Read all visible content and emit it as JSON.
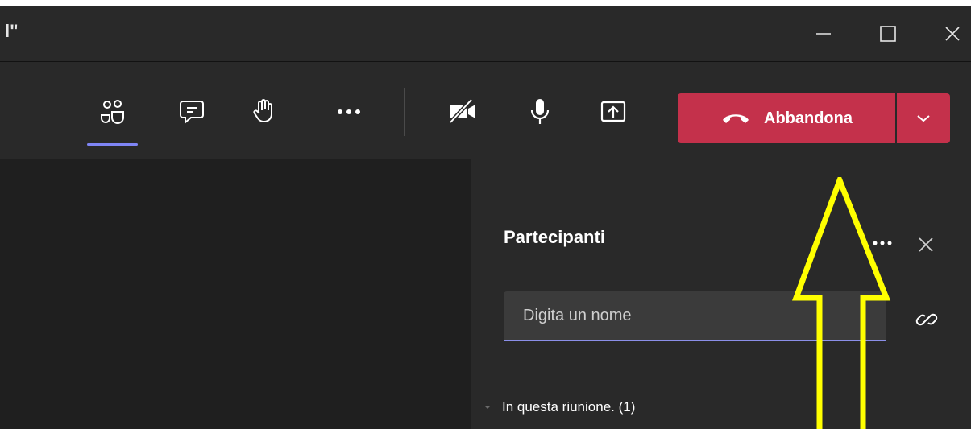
{
  "window": {
    "title_fragment": "l\"",
    "controls": [
      "minimize",
      "maximize",
      "close"
    ]
  },
  "toolbar": {
    "buttons": [
      {
        "name": "participants",
        "icon": "people-icon",
        "active": true
      },
      {
        "name": "chat",
        "icon": "chat-icon",
        "active": false
      },
      {
        "name": "raise-hand",
        "icon": "hand-icon",
        "active": false
      },
      {
        "name": "more",
        "icon": "more-icon",
        "active": false
      },
      {
        "name": "camera",
        "icon": "camera-off-icon",
        "active": false
      },
      {
        "name": "microphone",
        "icon": "microphone-icon",
        "active": false
      },
      {
        "name": "share",
        "icon": "share-screen-icon",
        "active": false
      }
    ],
    "leave_label": "Abbandona"
  },
  "participants_panel": {
    "title": "Partecipanti",
    "search_placeholder": "Digita un nome",
    "section_label": "In questa riunione. (1)"
  },
  "colors": {
    "accent": "#7f85f5",
    "leave_red": "#c4314b",
    "annotation_yellow": "#ffff00",
    "toolbar_bg": "#292929",
    "stage_bg": "#1f1f1f"
  }
}
